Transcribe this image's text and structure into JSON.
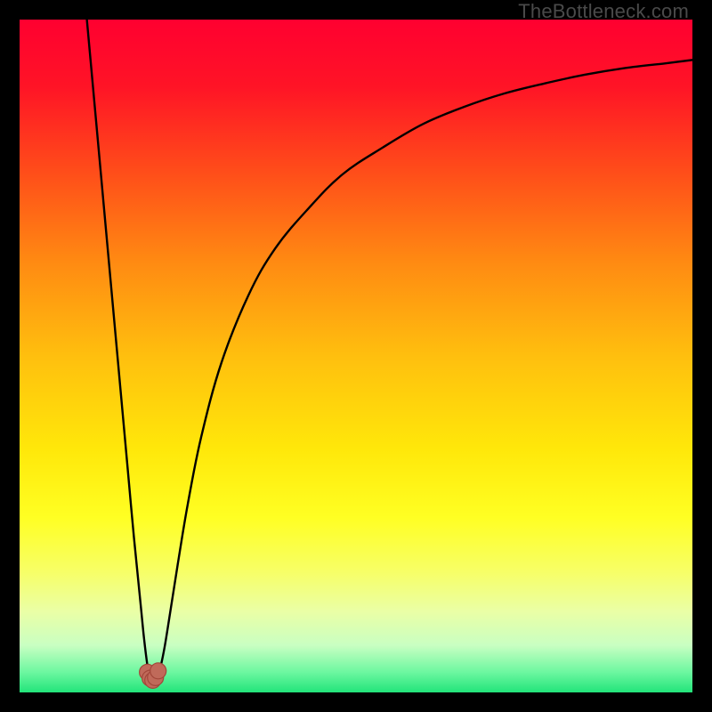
{
  "watermark": "TheBottleneck.com",
  "colors": {
    "frame": "#000000",
    "watermark": "#4a4a4a",
    "gradient_stops": [
      {
        "offset": 0.0,
        "color": "#ff0030"
      },
      {
        "offset": 0.1,
        "color": "#ff1426"
      },
      {
        "offset": 0.22,
        "color": "#ff4a1a"
      },
      {
        "offset": 0.36,
        "color": "#ff8a12"
      },
      {
        "offset": 0.5,
        "color": "#ffbf0e"
      },
      {
        "offset": 0.64,
        "color": "#ffe80a"
      },
      {
        "offset": 0.74,
        "color": "#ffff23"
      },
      {
        "offset": 0.82,
        "color": "#f7ff66"
      },
      {
        "offset": 0.88,
        "color": "#eaffa6"
      },
      {
        "offset": 0.93,
        "color": "#c9ffc2"
      },
      {
        "offset": 0.97,
        "color": "#6cf7a0"
      },
      {
        "offset": 1.0,
        "color": "#22e47a"
      }
    ],
    "curve": "#000000",
    "marker_fill": "#c06a5a",
    "marker_stroke": "#a2473a"
  },
  "chart_data": {
    "type": "line",
    "title": "",
    "xlabel": "",
    "ylabel": "",
    "xlim": [
      0,
      100
    ],
    "ylim": [
      0,
      100
    ],
    "x": [
      10,
      12,
      14,
      15,
      16,
      17,
      18,
      18.5,
      19,
      19.3,
      19.6,
      19.9,
      20.2,
      20.5,
      21,
      21.6,
      22.4,
      23.5,
      25,
      27,
      30,
      34,
      38,
      43,
      48,
      54,
      60,
      66,
      72,
      78,
      84,
      90,
      96,
      100
    ],
    "values": [
      100,
      78,
      56,
      45,
      34,
      23,
      13,
      8,
      4,
      2.5,
      2.0,
      1.8,
      1.9,
      2.3,
      4,
      7,
      12,
      19,
      28,
      38,
      49,
      59,
      66,
      72,
      77,
      81,
      84.5,
      87,
      89,
      90.5,
      91.8,
      92.8,
      93.5,
      94
    ],
    "markers": {
      "x": [
        19.0,
        19.4,
        19.8,
        20.2,
        20.6
      ],
      "y": [
        3.0,
        2.1,
        1.8,
        2.2,
        3.2
      ]
    }
  }
}
